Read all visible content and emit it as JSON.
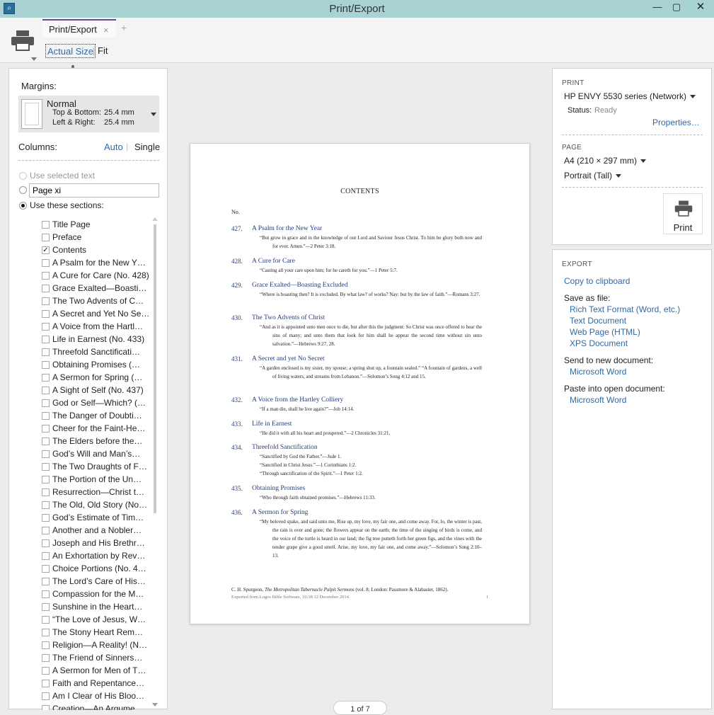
{
  "window": {
    "title": "Print/Export"
  },
  "tab": {
    "label": "Print/Export",
    "close": "×",
    "add": "+"
  },
  "toolbar": {
    "actual_size": "Actual Size",
    "separator": "|",
    "fit": "Fit"
  },
  "margins": {
    "label": "Margins:",
    "preset": "Normal",
    "top_bottom_label": "Top & Bottom:",
    "top_bottom": "25.4 mm",
    "left_right_label": "Left & Right:",
    "left_right": "25.4 mm"
  },
  "columns": {
    "label": "Columns:",
    "auto": "Auto",
    "separator": "|",
    "single": "Single"
  },
  "range": {
    "use_selected": "Use selected text",
    "page_value": "Page xi",
    "use_sections": "Use these sections:"
  },
  "sections": [
    {
      "label": "Title Page",
      "checked": ""
    },
    {
      "label": "Preface",
      "checked": ""
    },
    {
      "label": "Contents",
      "checked": "✓"
    },
    {
      "label": "A Psalm for the New Y…",
      "checked": ""
    },
    {
      "label": "A Cure for Care (No. 428)",
      "checked": ""
    },
    {
      "label": "Grace Exalted—Boasti…",
      "checked": ""
    },
    {
      "label": "The Two Advents of C…",
      "checked": ""
    },
    {
      "label": "A Secret and Yet No Se…",
      "checked": ""
    },
    {
      "label": "A Voice from the Hartl…",
      "checked": ""
    },
    {
      "label": "Life in Earnest (No. 433)",
      "checked": ""
    },
    {
      "label": "Threefold Sanctificati…",
      "checked": ""
    },
    {
      "label": "Obtaining Promises (…",
      "checked": ""
    },
    {
      "label": "A Sermon for Spring (…",
      "checked": ""
    },
    {
      "label": "A Sight of Self (No. 437)",
      "checked": ""
    },
    {
      "label": "God or Self—Which? (…",
      "checked": ""
    },
    {
      "label": "The Danger of Doubti…",
      "checked": ""
    },
    {
      "label": "Cheer for the Faint-He…",
      "checked": ""
    },
    {
      "label": "The Elders before the…",
      "checked": ""
    },
    {
      "label": "God’s Will and Man’s…",
      "checked": ""
    },
    {
      "label": "The Two Draughts of F…",
      "checked": ""
    },
    {
      "label": "The Portion of the Un…",
      "checked": ""
    },
    {
      "label": "Resurrection—Christ t…",
      "checked": ""
    },
    {
      "label": "The Old, Old Story (No…",
      "checked": ""
    },
    {
      "label": "God’s Estimate of Tim…",
      "checked": ""
    },
    {
      "label": "Another and a Nobler…",
      "checked": ""
    },
    {
      "label": "Joseph and His Brethr…",
      "checked": ""
    },
    {
      "label": "An Exhortation by Rev…",
      "checked": ""
    },
    {
      "label": "Choice Portions (No. 4…",
      "checked": ""
    },
    {
      "label": "The Lord’s Care of His…",
      "checked": ""
    },
    {
      "label": "Compassion for the M…",
      "checked": ""
    },
    {
      "label": "Sunshine in the Heart…",
      "checked": ""
    },
    {
      "label": "“The Love of Jesus, W…",
      "checked": ""
    },
    {
      "label": "The Stony Heart Rem…",
      "checked": ""
    },
    {
      "label": "Religion—A Reality! (N…",
      "checked": ""
    },
    {
      "label": "The Friend of Sinners…",
      "checked": ""
    },
    {
      "label": "A Sermon for Men of T…",
      "checked": ""
    },
    {
      "label": "Faith and Repentance…",
      "checked": ""
    },
    {
      "label": "Am I Clear of His Bloo…",
      "checked": ""
    },
    {
      "label": "Creation—An Argume…",
      "checked": ""
    }
  ],
  "preview": {
    "heading": "CONTENTS",
    "no_label": "No.",
    "entries": [
      {
        "num": "427.",
        "title": "A Psalm for the New Year",
        "quotes": [
          "“But grow in grace and in the knowledge of our Lord and Saviour Jesus Christ. To him be glory both now and for ever. Amen.”—2 Peter 3:18."
        ]
      },
      {
        "num": "428.",
        "title": "A Cure for Care",
        "quotes": [
          "“Casting all your care upon him; for he careth for you.”—1 Peter 5:7."
        ]
      },
      {
        "num": "429.",
        "title": "Grace Exalted—Boasting Excluded",
        "quotes": [
          "“Where is boasting then? It is excluded. By what law? of works? Nay: but by the law of faith.”—Romans 3:27."
        ]
      },
      {
        "num": "430.",
        "title": "The Two Advents of Christ",
        "quotes": [
          "“And as it is appointed unto men once to die, but after this the judgment: So Christ was once offered to bear the sins of many; and unto them that look for him shall he appear the second time without sin unto salvation.”—Hebrews 9:27, 28."
        ]
      },
      {
        "num": "431.",
        "title": "A Secret and yet No Secret",
        "quotes": [
          "“A garden enclosed is my sister, my spouse; a spring shut up, a fountain sealed.” “A fountain of gardens, a well of living waters, and streams from Lebanon.”—Solomon’s Song 4:12 and 15."
        ]
      },
      {
        "num": "432.",
        "title": "A Voice from the Hartley Colliery",
        "quotes": [
          "“If a man die, shall he live again?”—Job 14:14."
        ]
      },
      {
        "num": "433.",
        "title": "Life in Earnest",
        "quotes": [
          "“He did it with all his heart and prospered.”—2 Chronicles 31:21."
        ]
      },
      {
        "num": "434.",
        "title": "Threefold Sanctification",
        "quotes": [
          "“Sanctified by God the Father.”—Jude 1.",
          "“Sanctified in Christ Jesus.”—1 Corinthians 1:2.",
          "“Through sanctification of the Spirit.”—1 Peter 1:2."
        ]
      },
      {
        "num": "435.",
        "title": "Obtaining Promises",
        "quotes": [
          "“Who through faith obtained promises.”—Hebrews 11:33."
        ]
      },
      {
        "num": "436.",
        "title": "A Sermon for Spring",
        "quotes": [
          "“My beloved spake, and said unto me, Rise up, my love, my fair one, and come away. For, lo, the winter is past, the rain is over and gone; the flowers appear on the earth; the time of the singing of birds is come, and the voice of the turtle is heard in our land; the fig tree putteth forth her green figs, and the vines with the tender grape give a good smell. Arise, my love, my fair one, and come away.”—Solomon’s Song 2:10–13."
        ]
      }
    ],
    "footer_author": "C. H. Spurgeon, ",
    "footer_work": "The Metropolitan Tabernacle Pulpit Sermons",
    "footer_rest": " (vol. 8; London: Passmore & Alabaster, 1862).",
    "footer_export": "Exported from Logos Bible Software, 10:38 12 December 2014.",
    "page_number": "1"
  },
  "pager": {
    "text": "1 of 7"
  },
  "print": {
    "header": "PRINT",
    "printer": "HP ENVY 5530 series (Network)",
    "status_label": "Status:",
    "status": "Ready",
    "properties": "Properties…",
    "page_header": "PAGE",
    "paper": "A4 (210 × 297 mm)",
    "orientation": "Portrait (Tall)",
    "print_button": "Print"
  },
  "export": {
    "header": "EXPORT",
    "clipboard": "Copy to clipboard",
    "save_as": "Save as file:",
    "formats": [
      "Rich Text Format (Word, etc.)",
      "Text Document",
      "Web Page (HTML)",
      "XPS Document"
    ],
    "send_new": "Send to new document:",
    "send_new_app": "Microsoft Word",
    "paste_open": "Paste into open document:",
    "paste_open_app": "Microsoft Word"
  },
  "colors": {
    "titlebar": "#a9d3d3",
    "link": "#2f6aa5",
    "tab_accent": "#7a3f9d",
    "preview_title": "#2a3d7a"
  }
}
